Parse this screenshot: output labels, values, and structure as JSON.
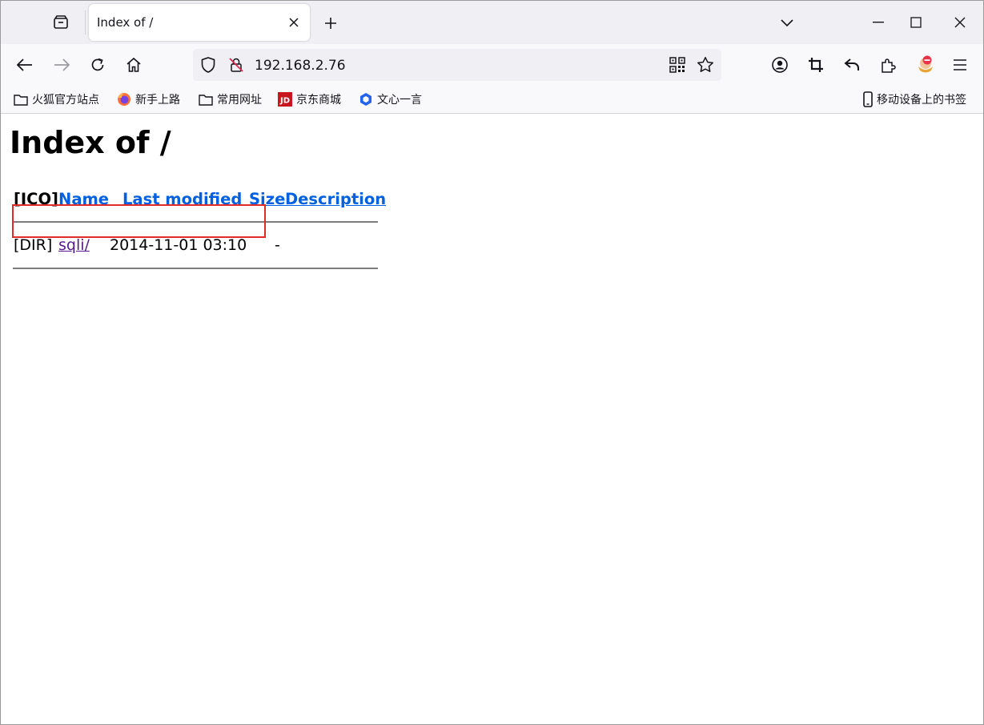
{
  "tab": {
    "title": "Index of /"
  },
  "address_bar": {
    "url": "192.168.2.76"
  },
  "bookmarks": [
    {
      "label": "火狐官方站点",
      "icon": "folder-icon"
    },
    {
      "label": "新手上路",
      "icon": "firefox-icon"
    },
    {
      "label": "常用网址",
      "icon": "folder-icon"
    },
    {
      "label": "京东商城",
      "icon": "jd-icon"
    },
    {
      "label": "文心一言",
      "icon": "wenxin-icon"
    }
  ],
  "mobile_bookmarks": {
    "label": "移动设备上的书签",
    "icon": "mobile-device-icon"
  },
  "page": {
    "title": "Index of /",
    "columns": {
      "icon": "[ICO]",
      "name": "Name",
      "last_modified": "Last modified",
      "size": "Size",
      "description": "Description"
    },
    "rows": [
      {
        "icon": "[DIR]",
        "name": "sqli/",
        "last_modified": "2014-11-01 03:10",
        "size": "-",
        "description": ""
      }
    ]
  },
  "colors": {
    "link": "#0060df",
    "visited_link": "#551a8b",
    "highlight": "#e02b2b"
  }
}
